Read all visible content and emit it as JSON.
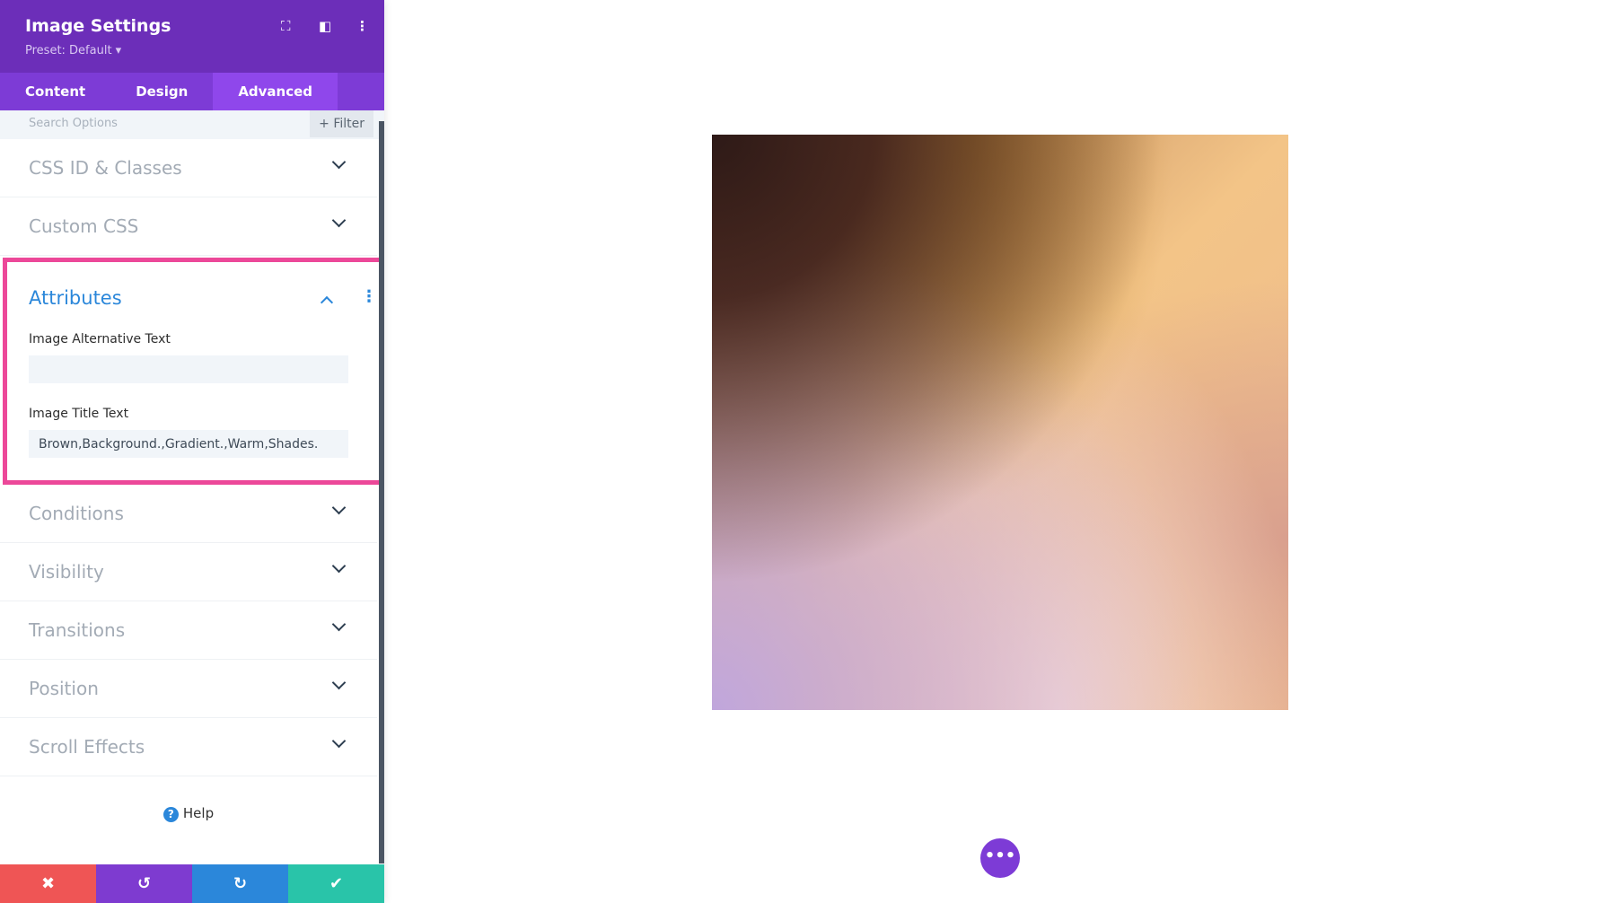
{
  "header": {
    "title": "Image Settings",
    "preset": "Preset: Default ▾",
    "icons": [
      "focus-icon",
      "split-view-icon",
      "more-vertical-icon"
    ]
  },
  "tabs": [
    {
      "label": "Content"
    },
    {
      "label": "Design"
    },
    {
      "label": "Advanced"
    }
  ],
  "search": {
    "placeholder": "Search Options",
    "filter": "+ Filter"
  },
  "sections_top": [
    {
      "label": "CSS ID & Classes"
    },
    {
      "label": "Custom CSS"
    }
  ],
  "attributes": {
    "title": "Attributes",
    "alt_label": "Image Alternative Text",
    "alt_value": "",
    "title_label": "Image Title Text",
    "title_value": "Brown,Background.,Gradient.,Warm,Shades."
  },
  "sections_bottom": [
    {
      "label": "Conditions"
    },
    {
      "label": "Visibility"
    },
    {
      "label": "Transitions"
    },
    {
      "label": "Position"
    },
    {
      "label": "Scroll Effects"
    }
  ],
  "help": "Help",
  "actions": {
    "cancel": "✖",
    "undo": "↺",
    "redo": "↻",
    "save": "✔"
  },
  "colors": {
    "header": "#6c2eb9",
    "accent": "#2b87da",
    "highlight": "#ec4899",
    "cancel": "#ef5555",
    "undo": "#7e3bd0",
    "redo": "#2b87da",
    "save": "#29c4a9"
  }
}
